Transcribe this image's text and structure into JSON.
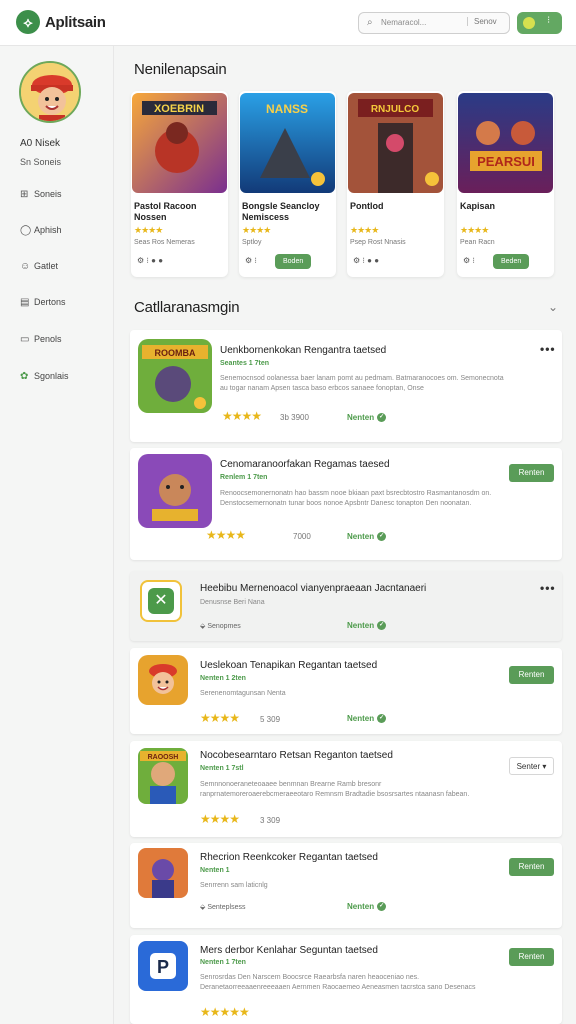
{
  "header": {
    "app_title": "Aplitsain",
    "search_placeholder": "Nemaracol...",
    "search_button": "Senov"
  },
  "sidebar": {
    "profile_name": "A0 Nisek",
    "profile_sub": "Sn Soneis",
    "items": [
      {
        "label": "Soneis",
        "icon": "grid-icon"
      },
      {
        "label": "Aphish",
        "icon": "chat-icon"
      },
      {
        "label": "Gatlet",
        "icon": "face-icon"
      },
      {
        "label": "Dertons",
        "icon": "doc-icon"
      },
      {
        "label": "Penols",
        "icon": "window-icon"
      },
      {
        "label": "Sgonlais",
        "icon": "leaf-icon"
      }
    ]
  },
  "featured": {
    "title": "Nenilenapsain",
    "items": [
      {
        "name": "Pastol Racoon Nossen",
        "meta": "Seas Ros Nemeras",
        "foot": "⚙ ⁝ ● ●",
        "button": ""
      },
      {
        "name": "Bongsle Seancloy Nemiscess",
        "meta": "Sptloy",
        "foot": "⚙ ⁝",
        "button": "Boden"
      },
      {
        "name": "Pontlod",
        "meta": "Psep Rost Nnasis",
        "foot": "⚙ ⁝ ● ●",
        "button": ""
      },
      {
        "name": "Kapisan",
        "meta": "Pean Racn",
        "foot": "⚙ ⁝",
        "button": "Beden"
      }
    ]
  },
  "catalog": {
    "title": "Catllaranasmgin",
    "cards": [
      {
        "title": "Uenkbornenkokan Rengantra taetsed",
        "badge": "Seantes 1 7ten",
        "desc": "Senemocnsod oolanessa baer lanam pomt au pedmam. Batmaranocoes om. Semonecnota au togar nanam Apsen tasca baso erbcos sanaee fonoptan, Onse",
        "rating": "3b 3900",
        "status": "Nenten",
        "has_button": false
      },
      {
        "title": "Cenomaranoorfakan Regamas taesed",
        "badge": "Renlem 1 7ten",
        "desc": "Renoocsemonernonatn hao bassm nooe bkiaan paxt bsrecbtostro Rasmantanosdm on. Denstocsemernonatn tunar boos nonoe Apsbntr Danesc tonapton Den noonatan.",
        "rating": "7000",
        "status": "Nenten",
        "button": "Renten",
        "has_button": true
      },
      {
        "title": "Heebibu Mernenoacol vianyenpraeaan Jacntanaeri",
        "badge": "",
        "desc": "Denusnse Beri Nana",
        "footer": "Senopmes",
        "status": "Nenten",
        "has_button": false
      },
      {
        "title": "Ueslekoan Tenapikan Regantan taetsed",
        "badge": "Nenten 1 2ten",
        "desc": "Serenenomtagunsan Nenta",
        "rating": "5 309",
        "status": "Nenten",
        "button": "Renten",
        "has_button": true
      },
      {
        "title": "Nocobesearntaro Retsan Reganton taetsed",
        "badge": "Nenten 1 7stl",
        "desc": "Semnnonoeraneteoaaee benmnan Brearne Ramb bresonr ranprnatemoreroaerebcmeraeeotaro Remnsm Bradtadie bsosrsartes ntaanasn fabean.",
        "rating": "3 309",
        "button": "Senter",
        "has_button": true
      },
      {
        "title": "Rhecrion Reenkcoker Regantan taetsed",
        "badge": "Nenten 1",
        "desc": "Senrrenn sam laticnlg",
        "footer": "Senteplsess",
        "status": "Nenten",
        "button": "Renten",
        "has_button": true
      },
      {
        "title": "Mers derbor Kenlahar Seguntan taetsed",
        "badge": "Nenten 1 7ten",
        "desc": "Senrosrdas Den Narscem Boocsrce Raearbsfa naren heaoceniao nes. Deranetaorreeaaenreeeaaen Aernmen Raocaemeo Aeneasmen tacrstca sano Desenacs",
        "button": "Renten",
        "has_button": true
      }
    ]
  }
}
